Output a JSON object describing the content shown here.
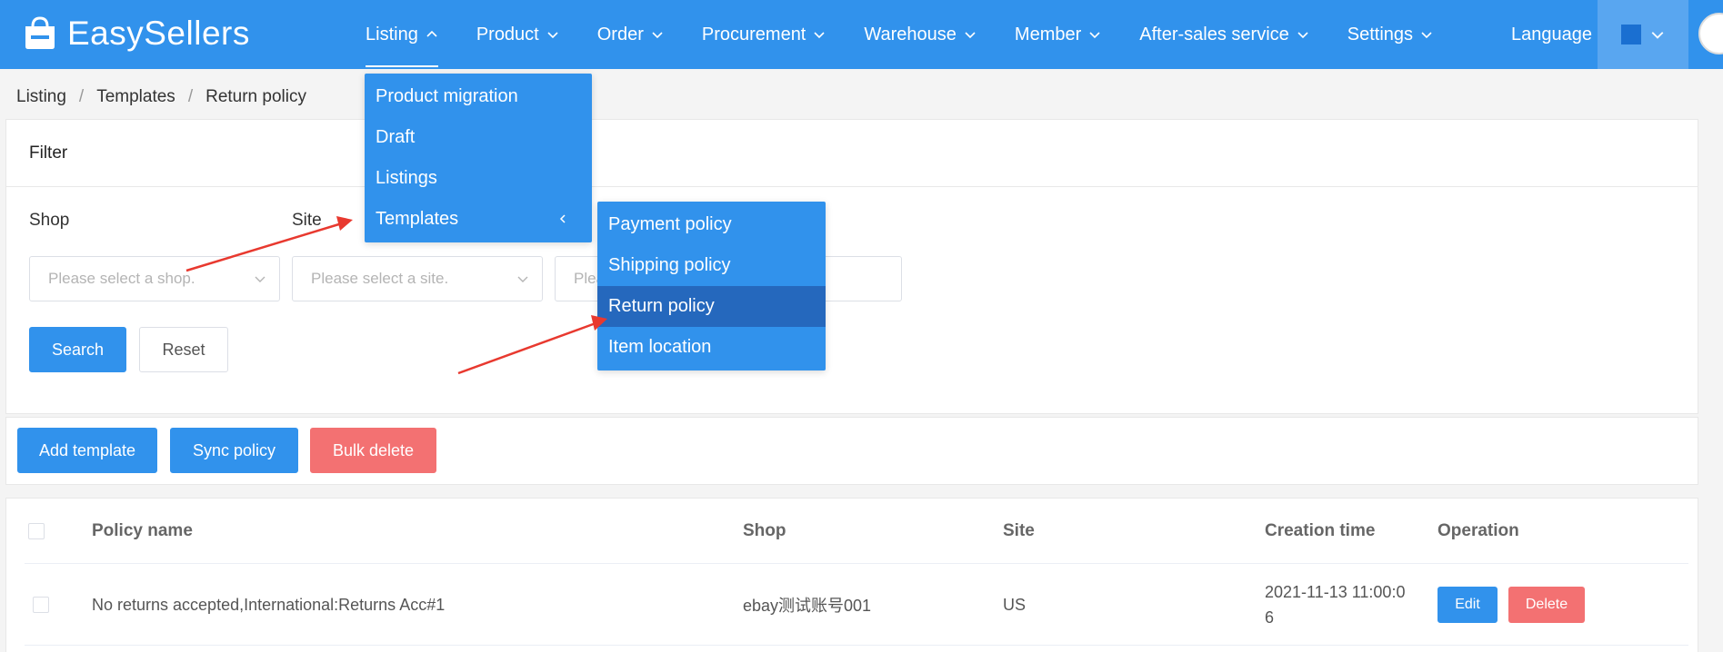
{
  "brand": {
    "name": "EasySellers"
  },
  "nav": {
    "items": [
      {
        "label": "Listing",
        "active": true
      },
      {
        "label": "Product"
      },
      {
        "label": "Order"
      },
      {
        "label": "Procurement"
      },
      {
        "label": "Warehouse"
      },
      {
        "label": "Member"
      },
      {
        "label": "After-sales service"
      },
      {
        "label": "Settings"
      }
    ],
    "language_label": "Language"
  },
  "breadcrumb": [
    "Listing",
    "Templates",
    "Return policy"
  ],
  "filter": {
    "title": "Filter",
    "shop_label": "Shop",
    "site_label": "Site",
    "shop_placeholder": "Please select a shop.",
    "site_placeholder": "Please select a site.",
    "third_placeholder": "Plea",
    "search_button": "Search",
    "reset_button": "Reset"
  },
  "actions": {
    "add_template": "Add template",
    "sync_policy": "Sync policy",
    "bulk_delete": "Bulk delete"
  },
  "table": {
    "headers": [
      "Policy name",
      "Shop",
      "Site",
      "Creation time",
      "Operation"
    ],
    "rows": [
      {
        "policy_name": "No returns accepted,International:Returns Acc#1",
        "shop": "ebay测试账号001",
        "site": "US",
        "creation_time_line1": "2021-11-13 11:00:0",
        "creation_time_line2": "6",
        "edit_label": "Edit",
        "delete_label": "Delete"
      }
    ]
  },
  "listing_menu": {
    "items": [
      "Product migration",
      "Draft",
      "Listings",
      "Templates"
    ]
  },
  "templates_submenu": {
    "items": [
      "Payment policy",
      "Shipping policy",
      "Return policy",
      "Item location"
    ],
    "selected": "Return policy"
  },
  "colors": {
    "primary": "#3192ec",
    "danger": "#f37172",
    "menu_selected": "#2568bd",
    "annotation_arrow": "#e8392f"
  }
}
